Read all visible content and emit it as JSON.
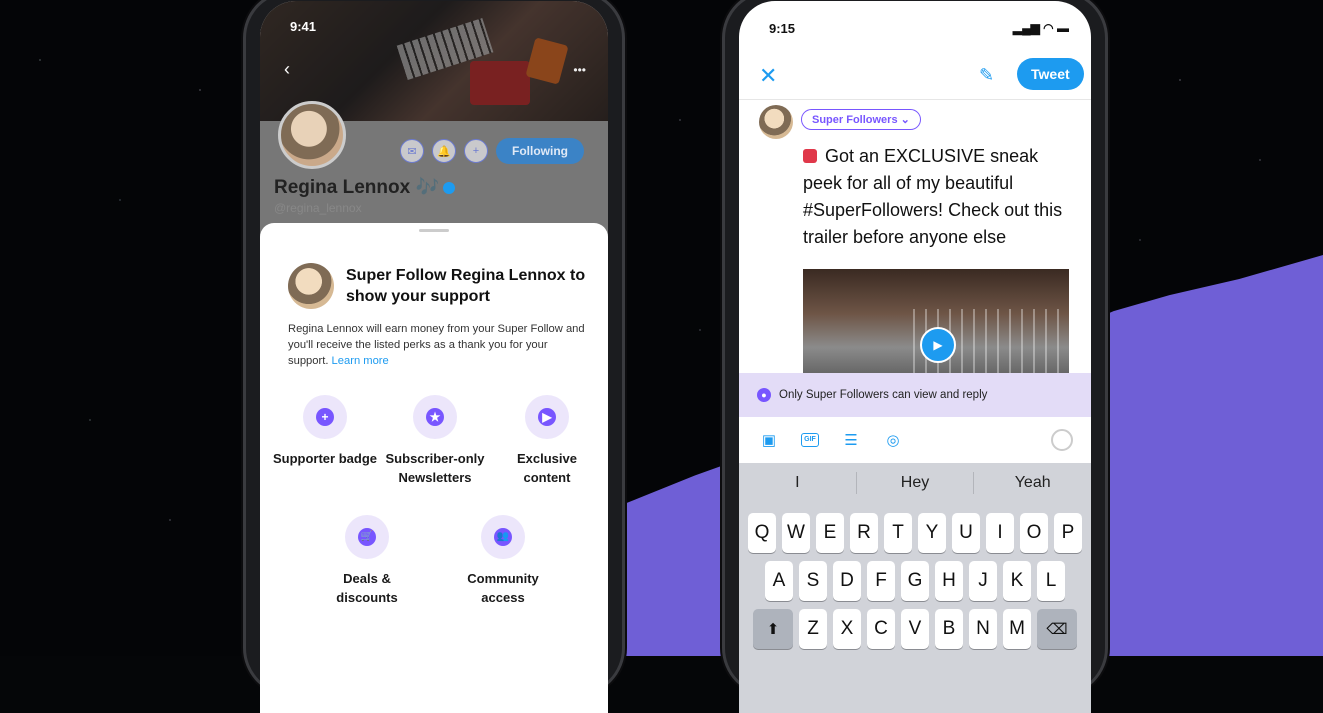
{
  "left_phone": {
    "time": "9:41",
    "back_icon": "chevron-left",
    "more_icon": "•••",
    "profile": {
      "name": "Regina Lennox 🎶",
      "handle": "@regina_lennox",
      "following_label": "Following",
      "icons": [
        "mail-icon",
        "bell-icon",
        "plus-icon"
      ]
    },
    "sheet": {
      "title": "Super Follow Regina Lennox to show your support",
      "description": "Regina Lennox will earn money from your Super Follow and you'll receive the listed perks as a thank you for your support.",
      "learn_more": "Learn more",
      "perks": [
        {
          "label": "Supporter badge",
          "icon": "+"
        },
        {
          "label": "Subscriber-only Newsletters",
          "icon": "★"
        },
        {
          "label": "Exclusive content",
          "icon": "▶"
        },
        {
          "label": "Deals & discounts",
          "icon": "🛒"
        },
        {
          "label": "Community access",
          "icon": "👥"
        }
      ]
    }
  },
  "right_phone": {
    "time": "9:15",
    "close_icon": "✕",
    "tweet_button": "Tweet",
    "audience": "Super Followers ⌄",
    "tweet_text": "Got an EXCLUSIVE sneak peek for all of my beautiful #SuperFollowers! Check out this trailer before anyone else",
    "notice": "Only Super Followers can view and reply",
    "toolbar_icons": [
      "image-icon",
      "GIF",
      "poll-icon",
      "location-icon"
    ],
    "suggestions": [
      "I",
      "Hey",
      "Yeah"
    ],
    "keyboard": {
      "row1": [
        "Q",
        "W",
        "E",
        "R",
        "T",
        "Y",
        "U",
        "I",
        "O",
        "P"
      ],
      "row2": [
        "A",
        "S",
        "D",
        "F",
        "G",
        "H",
        "J",
        "K",
        "L"
      ],
      "row3": [
        "Z",
        "X",
        "C",
        "V",
        "B",
        "N",
        "M"
      ],
      "shift_icon": "⬆",
      "delete_icon": "⌫"
    }
  }
}
